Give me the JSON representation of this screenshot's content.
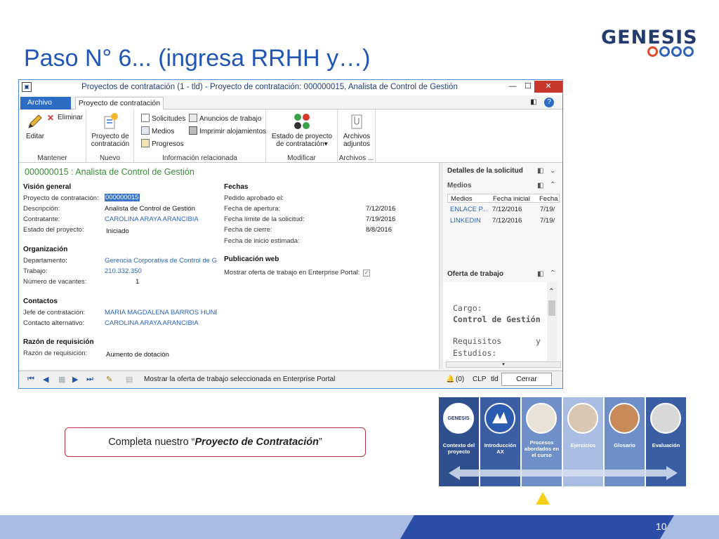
{
  "slide": {
    "title": "Paso N° 6... (ingresa RRHH y…)",
    "logo_text": "GENESIS",
    "page_number": "10",
    "callout_prefix": "Completa nuestro “",
    "callout_emphasis": "Proyecto de Contratación",
    "callout_suffix": "”"
  },
  "window": {
    "title": "Proyectos de contratación (1 - tld) - Proyecto de contratación: 000000015, Analista de Control de Gestión",
    "tabs": {
      "archivo": "Archivo",
      "proyecto": "Proyecto de contratación"
    },
    "ribbon": {
      "editar": "Editar",
      "eliminar": "Eliminar",
      "grp_mantener": "Mantener",
      "proyecto_line1": "Proyecto de",
      "proyecto_line2": "contratación",
      "grp_nuevo": "Nuevo",
      "solicitudes": "Solicitudes",
      "medios": "Medios",
      "progresos": "Progresos",
      "anuncios": "Anuncios de trabajo",
      "imprimir": "Imprimir alojamientos",
      "grp_info": "Información relacionada",
      "estado_line1": "Estado de proyecto",
      "estado_line2": "de contratación",
      "grp_modificar": "Modificar",
      "archivos_line1": "Archivos",
      "archivos_line2": "adjuntos",
      "grp_archivos": "Archivos ..."
    },
    "form": {
      "record_title": "000000015 : Analista de Control de Gestión",
      "vision": {
        "heading": "Visión general",
        "proyecto_label": "Proyecto de contratación:",
        "proyecto_value": "000000015",
        "descripcion_label": "Descripción:",
        "descripcion_value": "Analista de Control de Gestión",
        "contratante_label": "Contratante:",
        "contratante_value": "CAROLINA ARAYA ARANCIBIA",
        "estado_label": "Estado del proyecto:",
        "estado_value": "Iniciado"
      },
      "organizacion": {
        "heading": "Organización",
        "departamento_label": "Departamento:",
        "departamento_value": "Gerencia Corporativa de Control de G",
        "trabajo_label": "Trabajo:",
        "trabajo_value": "210.332.350",
        "vacantes_label": "Número de vacantes:",
        "vacantes_value": "1"
      },
      "contactos": {
        "heading": "Contactos",
        "jefe_label": "Jefe de contratación:",
        "jefe_value": "MARIA MAGDALENA BARROS HUNEI",
        "alternativo_label": "Contacto alternativo:",
        "alternativo_value": "CAROLINA ARAYA ARANCIBIA"
      },
      "requisicion": {
        "heading": "Razón de requisición",
        "razon_label": "Razón de requisición:",
        "razon_value": "Aumento de dotación"
      },
      "fechas": {
        "heading": "Fechas",
        "pedido_label": "Pedido aprobado el:",
        "apertura_label": "Fecha de apertura:",
        "apertura_value": "7/12/2016",
        "limite_label": "Fecha límite de la solicitud:",
        "limite_value": "7/19/2016",
        "cierre_label": "Fecha de cierre:",
        "cierre_value": "8/8/2016",
        "inicio_label": "Fecha de inicio estimada:"
      },
      "publicacion": {
        "heading": "Publicación web",
        "mostrar_label": "Mostrar oferta de trabajo en Enterprise Portal:"
      }
    },
    "factbox": {
      "detalles": "Detalles de la solicitud",
      "medios": "Medios",
      "col_medios": "Medios",
      "col_fecha": "Fecha inicial",
      "col_fecha2": "Fecha",
      "rows": [
        {
          "medio": "ENLACE P...",
          "fecha": "7/12/2016",
          "fecha2": "7/19/"
        },
        {
          "medio": "LINKEDIN",
          "fecha": "7/12/2016",
          "fecha2": "7/19/"
        }
      ],
      "oferta": "Oferta de trabajo",
      "cargo_label": "Cargo:",
      "cargo_value": "Control de Gestión",
      "requisitos": "Requisitos",
      "requisitos_y": "y",
      "estudios": "Estudios:"
    },
    "status": {
      "message": "Mostrar la oferta de trabajo seleccionada en Enterprise Portal",
      "alerts": "(0)",
      "currency": "CLP",
      "company": "tld",
      "cerrar": "Cerrar"
    }
  },
  "roadmap": {
    "tiles": [
      {
        "label": "Contexto del proyecto",
        "color": "#2f4f8f"
      },
      {
        "label": "Introducción AX",
        "color": "#3a5ea3"
      },
      {
        "label": "Procesos abordados en el curso",
        "color": "#6f8fc9"
      },
      {
        "label": "Ejercicios",
        "color": "#a9bde3"
      },
      {
        "label": "Glosario",
        "color": "#6f8fc9"
      },
      {
        "label": "Evaluación",
        "color": "#3a5ea3"
      }
    ],
    "inner_logo": "GENESIS"
  },
  "colors": {
    "title_blue": "#1f56b3",
    "window_border": "#4a8ad0",
    "accent_green": "#3a8a3a",
    "callout_border": "#b5343a",
    "footer_dark": "#2b4fa8",
    "footer_light": "#a9bde3"
  }
}
